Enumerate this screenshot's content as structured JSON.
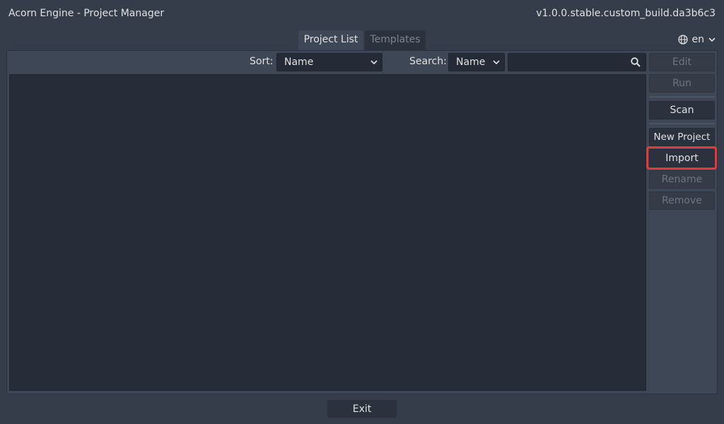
{
  "window": {
    "title": "Acorn Engine - Project Manager",
    "version": "v1.0.0.stable.custom_build.da3b6c3"
  },
  "tabs": [
    {
      "label": "Project List",
      "active": true
    },
    {
      "label": "Templates",
      "active": false
    }
  ],
  "language": {
    "value": "en",
    "icon": "globe-icon"
  },
  "toolbar": {
    "sort_label": "Sort:",
    "sort_value": "Name",
    "search_label": "Search:",
    "search_mode_value": "Name",
    "search_value": "",
    "search_placeholder": ""
  },
  "sidebar": {
    "edit": "Edit",
    "run": "Run",
    "scan": "Scan",
    "new_project": "New Project",
    "import": "Import",
    "rename": "Rename",
    "remove": "Remove"
  },
  "footer": {
    "exit": "Exit"
  },
  "colors": {
    "background": "#363d4a",
    "panel": "#3e4756",
    "list_background": "#262c38",
    "highlight": "#e0393e"
  }
}
